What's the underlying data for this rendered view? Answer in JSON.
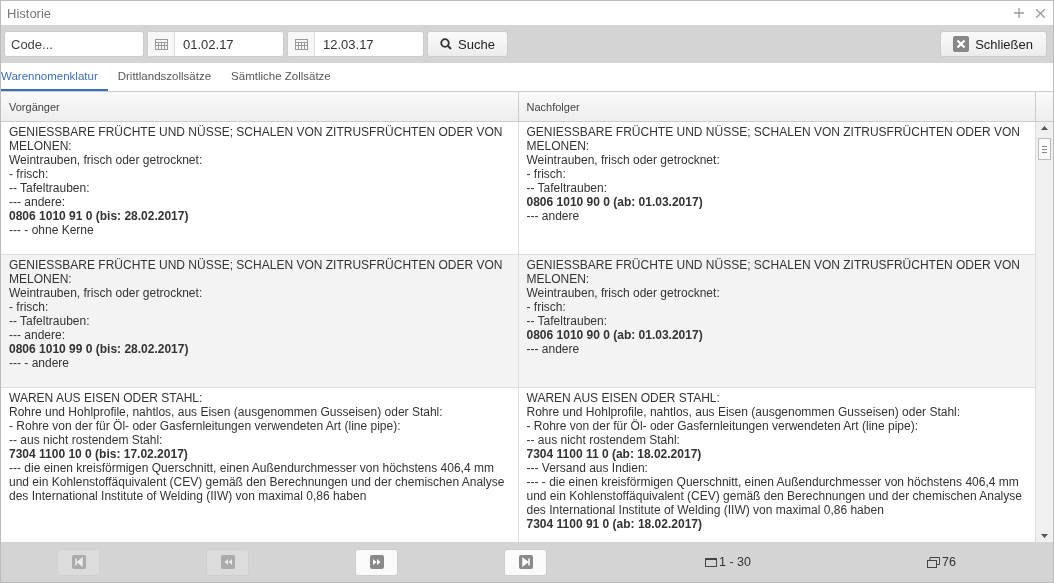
{
  "window": {
    "title": "Historie"
  },
  "toolbar": {
    "code": {
      "placeholder": "Code..."
    },
    "date_from": {
      "value": "01.02.17"
    },
    "date_to": {
      "value": "12.03.17"
    },
    "search_button": "Suche",
    "close_button": "Schließen"
  },
  "tabs": [
    {
      "label": "Warennomenklatur",
      "selected": true
    },
    {
      "label": "Drittlandszollsätze",
      "selected": false
    },
    {
      "label": "Sämtliche Zollsätze",
      "selected": false
    }
  ],
  "table": {
    "columns": [
      "Vorgänger",
      "Nachfolger"
    ],
    "rows": [
      {
        "cells": [
          [
            {
              "text": "GENIESSBARE FRÜCHTE UND NÜSSE; SCHALEN VON ZITRUSFRÜCHTEN ODER VON MELONEN:",
              "bold": false
            },
            {
              "text": "Weintrauben, frisch oder getrocknet:",
              "bold": false
            },
            {
              "text": "- frisch:",
              "bold": false
            },
            {
              "text": "-- Tafeltrauben:",
              "bold": false
            },
            {
              "text": "--- andere:",
              "bold": false
            },
            {
              "text": "0806 1010 91 0 (bis: 28.02.2017)",
              "bold": true
            },
            {
              "text": "--- - ohne Kerne",
              "bold": false
            }
          ],
          [
            {
              "text": "GENIESSBARE FRÜCHTE UND NÜSSE; SCHALEN VON ZITRUSFRÜCHTEN ODER VON MELONEN:",
              "bold": false
            },
            {
              "text": "Weintrauben, frisch oder getrocknet:",
              "bold": false
            },
            {
              "text": "- frisch:",
              "bold": false
            },
            {
              "text": "-- Tafeltrauben:",
              "bold": false
            },
            {
              "text": "0806 1010 90 0 (ab: 01.03.2017)",
              "bold": true
            },
            {
              "text": "--- andere",
              "bold": false
            }
          ]
        ]
      },
      {
        "cells": [
          [
            {
              "text": "GENIESSBARE FRÜCHTE UND NÜSSE; SCHALEN VON ZITRUSFRÜCHTEN ODER VON MELONEN:",
              "bold": false
            },
            {
              "text": "Weintrauben, frisch oder getrocknet:",
              "bold": false
            },
            {
              "text": "- frisch:",
              "bold": false
            },
            {
              "text": "-- Tafeltrauben:",
              "bold": false
            },
            {
              "text": "--- andere:",
              "bold": false
            },
            {
              "text": "0806 1010 99 0 (bis: 28.02.2017)",
              "bold": true
            },
            {
              "text": "--- - andere",
              "bold": false
            }
          ],
          [
            {
              "text": "GENIESSBARE FRÜCHTE UND NÜSSE; SCHALEN VON ZITRUSFRÜCHTEN ODER VON MELONEN:",
              "bold": false
            },
            {
              "text": "Weintrauben, frisch oder getrocknet:",
              "bold": false
            },
            {
              "text": "- frisch:",
              "bold": false
            },
            {
              "text": "-- Tafeltrauben:",
              "bold": false
            },
            {
              "text": "0806 1010 90 0 (ab: 01.03.2017)",
              "bold": true
            },
            {
              "text": "--- andere",
              "bold": false
            }
          ]
        ]
      },
      {
        "cells": [
          [
            {
              "text": "WAREN AUS EISEN ODER STAHL:",
              "bold": false
            },
            {
              "text": "Rohre und Hohlprofile, nahtlos, aus Eisen (ausgenommen Gusseisen) oder Stahl:",
              "bold": false
            },
            {
              "text": "- Rohre von der für Öl- oder Gasfernleitungen verwendeten Art (line pipe):",
              "bold": false
            },
            {
              "text": "-- aus nicht rostendem Stahl:",
              "bold": false
            },
            {
              "text": "7304 1100 10 0 (bis: 17.02.2017)",
              "bold": true
            },
            {
              "text": "--- die einen kreisförmigen Querschnitt, einen Außendurchmesser von höchstens 406,4 mm und ein Kohlenstoffäquivalent (CEV) gemäß den Berechnungen und der chemischen Analyse des International Institute of Welding (IIW) von maximal 0,86 haben",
              "bold": false
            }
          ],
          [
            {
              "text": "WAREN AUS EISEN ODER STAHL:",
              "bold": false
            },
            {
              "text": "Rohre und Hohlprofile, nahtlos, aus Eisen (ausgenommen Gusseisen) oder Stahl:",
              "bold": false
            },
            {
              "text": "- Rohre von der für Öl- oder Gasfernleitungen verwendeten Art (line pipe):",
              "bold": false
            },
            {
              "text": "-- aus nicht rostendem Stahl:",
              "bold": false
            },
            {
              "text": "7304 1100 11 0 (ab: 18.02.2017)",
              "bold": true
            },
            {
              "text": "--- Versand aus Indien:",
              "bold": false
            },
            {
              "text": "--- - die einen kreisförmigen Querschnitt, einen Außendurchmesser von höchstens 406,4 mm und ein Kohlenstoffäquivalent (CEV) gemäß den Berechnungen und der chemischen Analyse des International Institute of Welding (IIW) von maximal 0,86 haben",
              "bold": false
            },
            {
              "text": "7304 1100 91 0 (ab: 18.02.2017)",
              "bold": true
            }
          ]
        ]
      }
    ]
  },
  "pager": {
    "buttons": [
      {
        "kind": "first",
        "disabled": true
      },
      {
        "kind": "prev",
        "disabled": true
      },
      {
        "kind": "next",
        "disabled": false
      },
      {
        "kind": "last",
        "disabled": false
      }
    ],
    "range": "1 - 30",
    "total": "76"
  }
}
